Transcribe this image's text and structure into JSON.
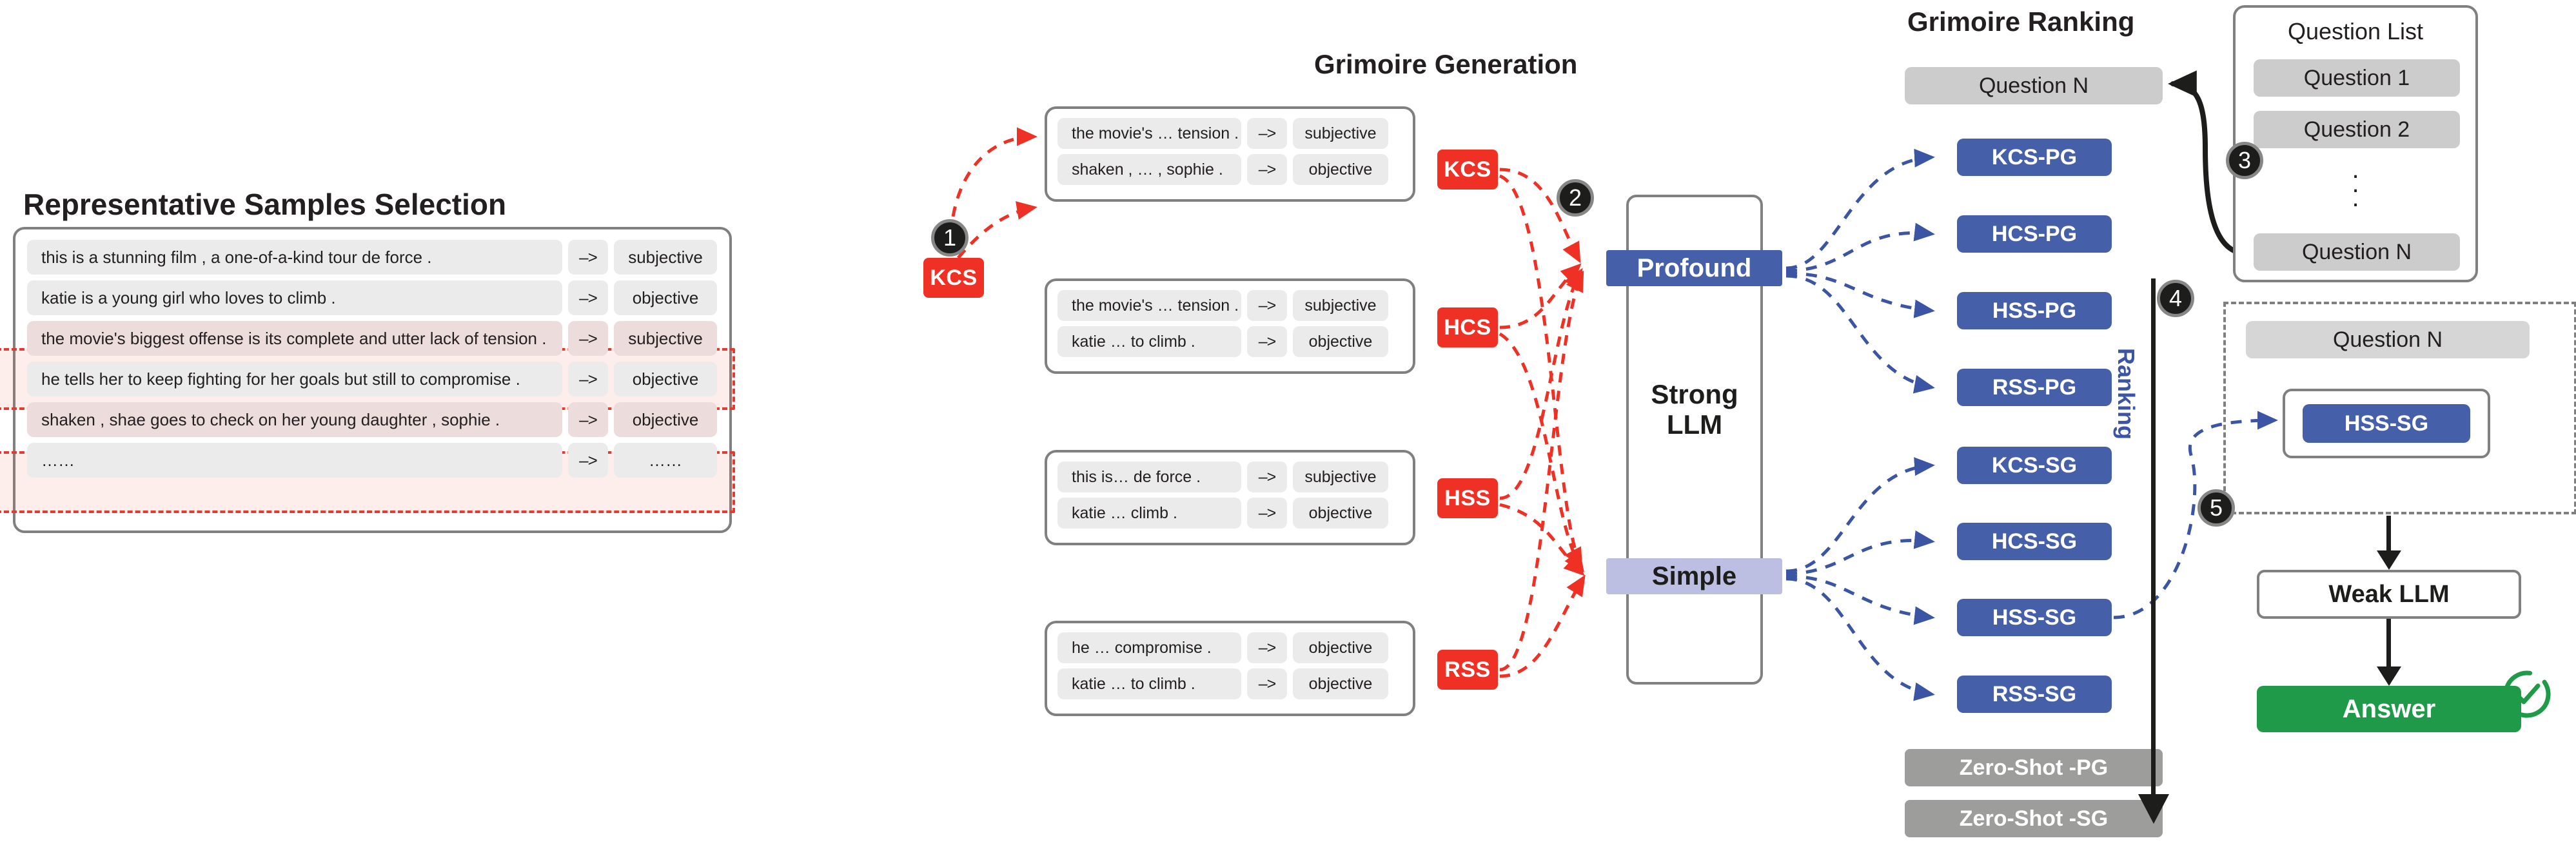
{
  "titles": {
    "samples": "Representative Samples Selection",
    "generation": "Grimoire Generation",
    "ranking": "Grimoire Ranking"
  },
  "samples_table": {
    "arrow": "–>",
    "rows": [
      {
        "sentence": "this is a stunning film , a one-of-a-kind tour de force .",
        "label": "subjective",
        "highlighted": false
      },
      {
        "sentence": "katie is a young girl who loves to climb .",
        "label": "objective",
        "highlighted": false
      },
      {
        "sentence": "the movie's biggest offense is its complete and utter lack of tension .",
        "label": "subjective",
        "highlighted": true
      },
      {
        "sentence": "he tells her to keep fighting for her goals but still to compromise .",
        "label": "objective",
        "highlighted": false
      },
      {
        "sentence": "shaken , shae goes to check on her young daughter , sophie .",
        "label": "objective",
        "highlighted": true
      },
      {
        "sentence": "……",
        "label": "……",
        "highlighted": false
      }
    ]
  },
  "grimoires": [
    {
      "tag": "KCS",
      "rows": [
        {
          "sentence": "the movie's … tension .",
          "label": "subjective"
        },
        {
          "sentence": "shaken , … , sophie .",
          "label": "objective"
        }
      ]
    },
    {
      "tag": "HCS",
      "rows": [
        {
          "sentence": "the movie's … tension .",
          "label": "subjective"
        },
        {
          "sentence": "katie … to climb .",
          "label": "objective"
        }
      ]
    },
    {
      "tag": "HSS",
      "rows": [
        {
          "sentence": "this is… de force .",
          "label": "subjective"
        },
        {
          "sentence": "katie … climb .",
          "label": "objective"
        }
      ]
    },
    {
      "tag": "RSS",
      "rows": [
        {
          "sentence": "he … compromise .",
          "label": "objective"
        },
        {
          "sentence": "katie … to climb .",
          "label": "objective"
        }
      ]
    }
  ],
  "kcs_selection_tag": "KCS",
  "step_markers": [
    "1",
    "2",
    "3",
    "4",
    "5"
  ],
  "strong_llm": {
    "label_line1": "Strong",
    "label_line2": "LLM",
    "profound": "Profound",
    "simple": "Simple"
  },
  "ranking": {
    "question_top": "Question N",
    "axis_label": "Ranking",
    "grimoire_boxes": [
      "KCS-PG",
      "HCS-PG",
      "HSS-PG",
      "RSS-PG",
      "KCS-SG",
      "HCS-SG",
      "HSS-SG",
      "RSS-SG"
    ],
    "zero_shot": [
      "Zero-Shot -PG",
      "Zero-Shot -SG"
    ]
  },
  "question_list": {
    "title": "Question List",
    "items": [
      "Question 1",
      "Question 2",
      "Question N"
    ],
    "ellipsis": "⋮"
  },
  "inference": {
    "question": "Question N",
    "selected_grimoire": "HSS-SG",
    "weak_llm": "Weak LLM",
    "answer": "Answer"
  },
  "colors": {
    "accent_blue": "#4560a8",
    "light_blue": "#bdbfe2",
    "red": "#ee3124",
    "green": "#1f9a48",
    "gray": "#9d9d9c",
    "dashed_red": "#e03c31"
  }
}
